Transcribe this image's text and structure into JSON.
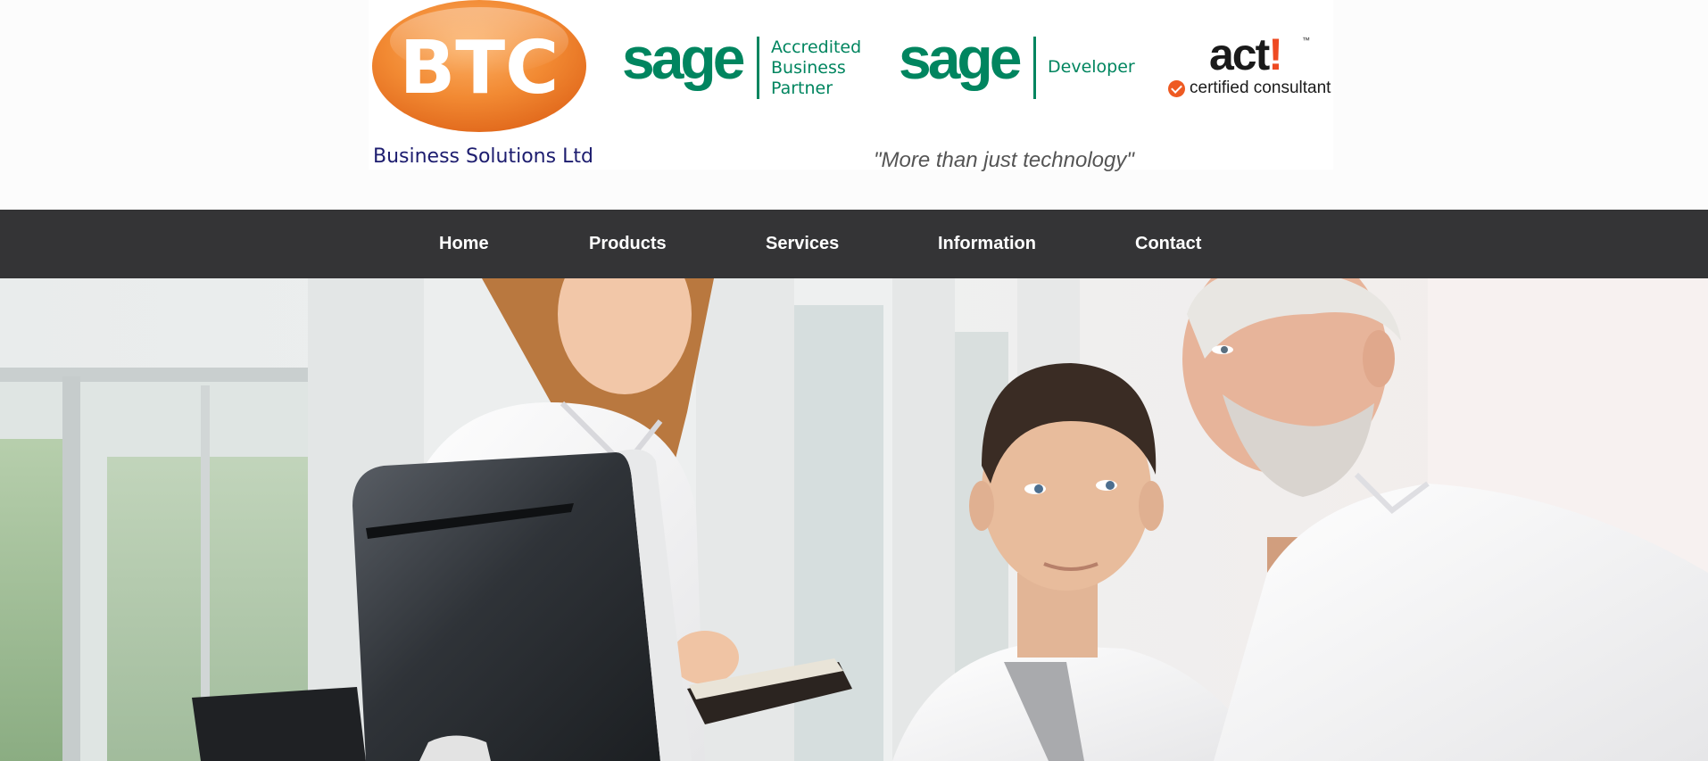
{
  "header": {
    "btc_logo_text": "BTC",
    "btc_subtitle": "Business Solutions Ltd",
    "sage_partner": {
      "wordmark": "sage",
      "line1": "Accredited",
      "line2": "Business",
      "line3": "Partner"
    },
    "sage_developer": {
      "wordmark": "sage",
      "label": "Developer"
    },
    "act_logo": {
      "wordmark": "act",
      "exclaim": "!",
      "tm": "™",
      "certified": "certified consultant"
    },
    "tagline": "\"More than just technology\""
  },
  "nav": {
    "items": [
      {
        "label": "Home"
      },
      {
        "label": "Products"
      },
      {
        "label": "Services"
      },
      {
        "label": "Information"
      },
      {
        "label": "Contact"
      }
    ]
  },
  "colors": {
    "btc_orange": "#f07c22",
    "sage_green": "#00855f",
    "act_orange": "#ee4a22",
    "nav_bg": "#343436",
    "subtitle_navy": "#1d1d6f"
  },
  "icons": {
    "certified_check": "check-circle-icon"
  }
}
